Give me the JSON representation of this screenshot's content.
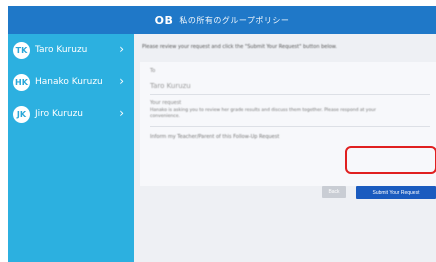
{
  "header": {
    "logo": "OB",
    "title": "私の所有のグループポリシー"
  },
  "sidebar": {
    "items": [
      {
        "initials": "TK",
        "label": "Taro Kuruzu"
      },
      {
        "initials": "HK",
        "label": "Hanako Kuruzu"
      },
      {
        "initials": "JK",
        "label": "Jiro Kuruzu"
      }
    ],
    "chevron": "›"
  },
  "main": {
    "instruction": "Please review your request and click the \"Submit Your Request\" button below.",
    "to_label": "To",
    "to_value": "Taro Kuruzu",
    "to_value_right": "",
    "field_label": "Your request",
    "body_text": "Hanako is asking you to review her grade results and discuss them together. Please respond at your convenience.",
    "checkbox_text": "Inform my Teacher/Parent of this Follow-Up Request",
    "cancel_label": "Back",
    "submit_label": "Submit Your Request"
  }
}
